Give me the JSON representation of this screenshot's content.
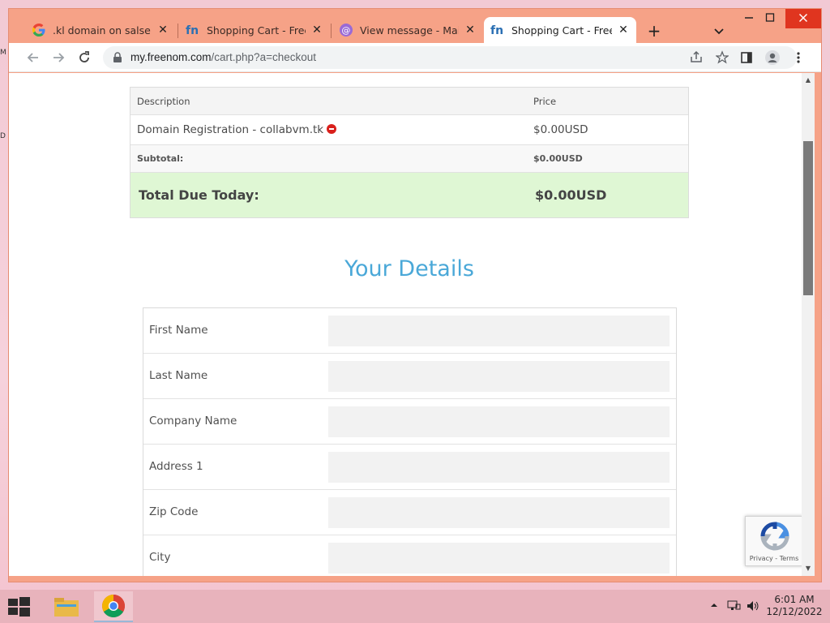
{
  "desktop": {
    "edge_glyph_top": "M",
    "edge_glyph_bottom": "D"
  },
  "browser": {
    "tabs": [
      {
        "title": ".kl domain on salse - Goo",
        "favicon": "google-icon",
        "active": false
      },
      {
        "title": "Shopping Cart - Freenom",
        "favicon": "freenom-icon",
        "active": false
      },
      {
        "title": "View message - Mail.tm",
        "favicon": "mailtm-icon",
        "active": false
      },
      {
        "title": "Shopping Cart - Freenom",
        "favicon": "freenom-icon",
        "active": true
      }
    ],
    "tab_close_glyph": "✕",
    "new_tab_glyph": "+",
    "url_host": "my.freenom.com",
    "url_path": "/cart.php?a=checkout"
  },
  "cart": {
    "headers": {
      "description": "Description",
      "price": "Price"
    },
    "item": {
      "description": "Domain Registration - collabvm.tk",
      "price": "$0.00USD"
    },
    "subtotal": {
      "label": "Subtotal:",
      "value": "$0.00USD"
    },
    "total": {
      "label": "Total Due Today:",
      "value": "$0.00USD"
    }
  },
  "details": {
    "title": "Your Details",
    "fields": [
      {
        "label": "First Name",
        "value": ""
      },
      {
        "label": "Last Name",
        "value": ""
      },
      {
        "label": "Company Name",
        "value": ""
      },
      {
        "label": "Address 1",
        "value": ""
      },
      {
        "label": "Zip Code",
        "value": ""
      },
      {
        "label": "City",
        "value": ""
      }
    ]
  },
  "recaptcha": {
    "links": "Privacy - Terms"
  },
  "taskbar": {
    "time": "6:01 AM",
    "date": "12/12/2022"
  },
  "colors": {
    "accent_title": "#4aa8d8",
    "total_bg": "#dff7d4",
    "tabbar_bg": "#f6a287"
  }
}
